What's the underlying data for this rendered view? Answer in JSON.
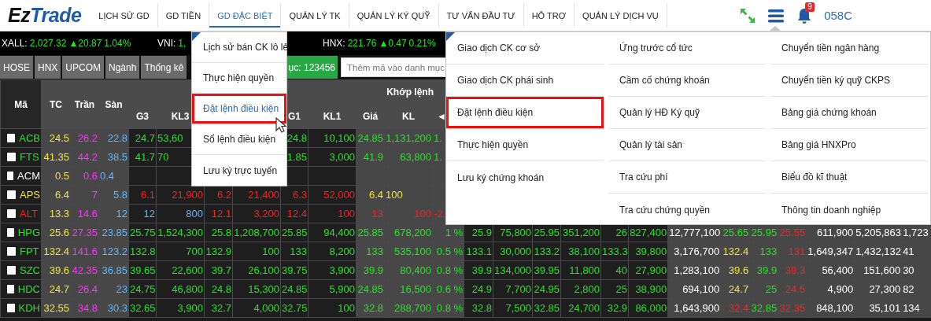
{
  "nav": {
    "logo": {
      "first": "Ez",
      "second": "Trade"
    },
    "items": [
      {
        "label": "LỊCH SỬ GD",
        "selected": false
      },
      {
        "label": "GD TIỀN",
        "selected": false
      },
      {
        "label": "GD ĐẶC BIỆT",
        "selected": true
      },
      {
        "label": "QUẢN LÝ TK",
        "selected": false
      },
      {
        "label": "QUẢN LÝ KÝ QUỸ",
        "selected": false
      },
      {
        "label": "TƯ VẤN ĐẦU TƯ",
        "selected": false
      },
      {
        "label": "HỖ TRỢ",
        "selected": false
      },
      {
        "label": "QUẢN LÝ DỊCH VỤ",
        "selected": false
      }
    ],
    "notifications": "9",
    "account": "058C"
  },
  "ticker": [
    {
      "label": "XALL:",
      "value": "2,027.32",
      "change": "▲20.87",
      "percent": "1.04%"
    },
    {
      "label": "VNI:",
      "value": "1,"
    },
    {
      "label": "HNX:",
      "value": "221.76",
      "change": "▲0.47",
      "percent": "0.21%"
    }
  ],
  "market_tabs": [
    "HOSE",
    "HNX",
    "UPCOM",
    "Ngành",
    "Thống kê"
  ],
  "watchlist_button": "ục: 123456",
  "add_symbol": {
    "placeholder": "Thêm mã vào danh mục"
  },
  "table": {
    "headers": [
      "Mã",
      "TC",
      "Trần",
      "Sàn"
    ],
    "group_header": "Khớp lệnh",
    "sub_headers": [
      "G3",
      "KL3",
      "G1",
      "KL1",
      "Giá",
      "KL",
      "◄"
    ],
    "rows": [
      {
        "symbol": "ACB",
        "color": "#22e622",
        "checked": false,
        "cells": [
          {
            "text": "24.5",
            "color": "#f0e43c"
          },
          {
            "text": "26.2",
            "color": "#ff33ff"
          },
          {
            "text": "22.8",
            "color": "#5cb8ff"
          },
          {
            "text": "24.7",
            "color": "#22e622"
          },
          {
            "text": "53,60",
            "color": "#22e622"
          },
          null,
          null,
          {
            "text": "24.8",
            "color": "#22e622"
          },
          {
            "text": "10,100",
            "color": "#22e622"
          },
          {
            "text": "24.85",
            "color": "#22e622"
          },
          {
            "text": "1,131,200",
            "color": "#22e622"
          },
          {
            "text": "1.",
            "color": "#22e622"
          },
          null,
          null,
          null,
          null,
          null,
          null,
          null,
          null,
          null,
          null,
          null,
          null,
          null
        ]
      },
      {
        "symbol": "FTS",
        "color": "#22e622",
        "checked": false,
        "cells": [
          {
            "text": "41.35",
            "color": "#f0e43c"
          },
          {
            "text": "44.2",
            "color": "#ff33ff"
          },
          {
            "text": "38.5",
            "color": "#5cb8ff"
          },
          {
            "text": "41.7",
            "color": "#22e622"
          },
          {
            "text": "70",
            "color": "#22e622"
          },
          null,
          null,
          {
            "text": "1.85",
            "color": "#22e622"
          },
          {
            "text": "3,000",
            "color": "#22e622"
          },
          {
            "text": "41.9",
            "color": "#22e622"
          },
          {
            "text": "63,800",
            "color": "#22e622"
          },
          {
            "text": "1.",
            "color": "#22e622"
          },
          null,
          null,
          null,
          null,
          null,
          null,
          null,
          null,
          null,
          null,
          null,
          null,
          null
        ]
      },
      {
        "symbol": "ACM",
        "color": "#ffffff",
        "checked": false,
        "cells": [
          {
            "text": "0.5",
            "color": "#f0e43c"
          },
          {
            "text": "0.6",
            "color": "#ff33ff"
          },
          {
            "text": "0.4",
            "color": "#5cb8ff"
          },
          null,
          null,
          null,
          null,
          null,
          null,
          null,
          null,
          null,
          null,
          null,
          null,
          null,
          null,
          null,
          null,
          null,
          null,
          null,
          null,
          null,
          null
        ]
      },
      {
        "symbol": "APS",
        "color": "#f0e43c",
        "checked": false,
        "cells": [
          {
            "text": "6.4",
            "color": "#f0e43c"
          },
          {
            "text": "7",
            "color": "#ff33ff"
          },
          {
            "text": "5.8",
            "color": "#5cb8ff"
          },
          {
            "text": "6.1",
            "color": "#ff2020"
          },
          {
            "text": "21,900",
            "color": "#ff2020"
          },
          {
            "text": "6.2",
            "color": "#ff2020"
          },
          {
            "text": "21,400",
            "color": "#ff2020"
          },
          {
            "text": "6.3",
            "color": "#ff2020"
          },
          {
            "text": "52,000",
            "color": "#ff2020"
          },
          {
            "text": "6.4",
            "color": "#f0e43c"
          },
          {
            "text": "100",
            "color": "#f0e43c"
          },
          null,
          null,
          null,
          null,
          null,
          null,
          null,
          null,
          null,
          null,
          null,
          null,
          null,
          null
        ]
      },
      {
        "symbol": "ALT",
        "color": "#ff2020",
        "checked": false,
        "cells": [
          {
            "text": "13.3",
            "color": "#f0e43c"
          },
          {
            "text": "14.6",
            "color": "#ff33ff"
          },
          {
            "text": "12",
            "color": "#5cb8ff"
          },
          {
            "text": "12",
            "color": "#5cb8ff"
          },
          {
            "text": "800",
            "color": "#5cb8ff"
          },
          {
            "text": "12.1",
            "color": "#ff2020"
          },
          {
            "text": "3,200",
            "color": "#ff2020"
          },
          {
            "text": "12.4",
            "color": "#ff2020"
          },
          {
            "text": "100",
            "color": "#ff2020"
          },
          {
            "text": "13",
            "color": "#ff2020"
          },
          {
            "text": "100",
            "color": "#ff2020"
          },
          {
            "text": "-2.",
            "color": "#ff2020"
          },
          null,
          null,
          null,
          null,
          null,
          null,
          null,
          null,
          null,
          null,
          null,
          null,
          null
        ]
      },
      {
        "symbol": "HPG",
        "color": "#22e622",
        "checked": false,
        "cells": [
          {
            "text": "25.6",
            "color": "#f0e43c"
          },
          {
            "text": "27.35",
            "color": "#ff33ff"
          },
          {
            "text": "23.85",
            "color": "#5cb8ff"
          },
          {
            "text": "25.75",
            "color": "#22e622"
          },
          {
            "text": "1,524,300",
            "color": "#22e622"
          },
          {
            "text": "25.8",
            "color": "#22e622"
          },
          {
            "text": "1,208,700",
            "color": "#22e622"
          },
          {
            "text": "25.85",
            "color": "#22e622"
          },
          {
            "text": "94,400",
            "color": "#22e622"
          },
          {
            "text": "25.85",
            "color": "#22e622"
          },
          {
            "text": "678,200",
            "color": "#22e622"
          },
          {
            "text": "1 %",
            "color": "#22e622"
          },
          {
            "text": "25.9",
            "color": "#22e622"
          },
          {
            "text": "75,800",
            "color": "#22e622"
          },
          {
            "text": "25.95",
            "color": "#22e622"
          },
          {
            "text": "351,200",
            "color": "#22e622"
          },
          {
            "text": "26",
            "color": "#22e622"
          },
          {
            "text": "827,400",
            "color": "#22e622"
          },
          {
            "text": "12,777,100",
            "color": "#ffffff"
          },
          {
            "text": "25.65",
            "color": "#22e622"
          },
          {
            "text": "25.95",
            "color": "#22e622"
          },
          {
            "text": "25.55",
            "color": "#ff2020"
          },
          {
            "text": "611,900",
            "color": "#ffffff"
          },
          {
            "text": "5,205,863",
            "color": "#ffffff"
          },
          {
            "text": "1,723",
            "color": "#ffffff"
          }
        ]
      },
      {
        "symbol": "FPT",
        "color": "#22e622",
        "checked": false,
        "cells": [
          {
            "text": "132.4",
            "color": "#f0e43c"
          },
          {
            "text": "141.6",
            "color": "#ff33ff"
          },
          {
            "text": "123.2",
            "color": "#5cb8ff"
          },
          {
            "text": "132.8",
            "color": "#22e622"
          },
          {
            "text": "700",
            "color": "#22e622"
          },
          {
            "text": "132.9",
            "color": "#22e622"
          },
          {
            "text": "100",
            "color": "#22e622"
          },
          {
            "text": "133",
            "color": "#22e622"
          },
          {
            "text": "8,200",
            "color": "#22e622"
          },
          {
            "text": "133",
            "color": "#22e622"
          },
          {
            "text": "535,100",
            "color": "#22e622"
          },
          {
            "text": "0.5 %",
            "color": "#22e622"
          },
          {
            "text": "133.1",
            "color": "#22e622"
          },
          {
            "text": "30,000",
            "color": "#22e622"
          },
          {
            "text": "133.2",
            "color": "#22e622"
          },
          {
            "text": "38,100",
            "color": "#22e622"
          },
          {
            "text": "133.3",
            "color": "#22e622"
          },
          {
            "text": "39,800",
            "color": "#22e622"
          },
          {
            "text": "3,176,700",
            "color": "#ffffff"
          },
          {
            "text": "132.4",
            "color": "#f0e43c"
          },
          {
            "text": "133",
            "color": "#22e622"
          },
          {
            "text": "131",
            "color": "#ff2020"
          },
          {
            "text": "1,649,347",
            "color": "#ffffff"
          },
          {
            "text": "1,432,132",
            "color": "#ffffff"
          },
          {
            "text": "41",
            "color": "#ffffff"
          }
        ]
      },
      {
        "symbol": "SZC",
        "color": "#22e622",
        "checked": false,
        "cells": [
          {
            "text": "39.6",
            "color": "#f0e43c"
          },
          {
            "text": "42.35",
            "color": "#ff33ff"
          },
          {
            "text": "36.85",
            "color": "#5cb8ff"
          },
          {
            "text": "39.65",
            "color": "#22e622"
          },
          {
            "text": "22,600",
            "color": "#22e622"
          },
          {
            "text": "39.7",
            "color": "#22e622"
          },
          {
            "text": "26,100",
            "color": "#22e622"
          },
          {
            "text": "39.75",
            "color": "#22e622"
          },
          {
            "text": "3,900",
            "color": "#22e622"
          },
          {
            "text": "39.9",
            "color": "#22e622"
          },
          {
            "text": "80,400",
            "color": "#22e622"
          },
          {
            "text": "0.8 %",
            "color": "#22e622"
          },
          {
            "text": "39.9",
            "color": "#22e622"
          },
          {
            "text": "134,000",
            "color": "#22e622"
          },
          {
            "text": "39.95",
            "color": "#22e622"
          },
          {
            "text": "11,800",
            "color": "#22e622"
          },
          {
            "text": "40",
            "color": "#22e622"
          },
          {
            "text": "27,900",
            "color": "#22e622"
          },
          {
            "text": "1,283,100",
            "color": "#ffffff"
          },
          {
            "text": "39.6",
            "color": "#f0e43c"
          },
          {
            "text": "39.9",
            "color": "#22e622"
          },
          {
            "text": "39.3",
            "color": "#ff2020"
          },
          {
            "text": "56,400",
            "color": "#ffffff"
          },
          {
            "text": "151,600",
            "color": "#ffffff"
          },
          {
            "text": "30",
            "color": "#ffffff"
          }
        ]
      },
      {
        "symbol": "HDC",
        "color": "#22e622",
        "checked": false,
        "cells": [
          {
            "text": "24.7",
            "color": "#f0e43c"
          },
          {
            "text": "26.4",
            "color": "#ff33ff"
          },
          {
            "text": "23",
            "color": "#5cb8ff"
          },
          {
            "text": "24.75",
            "color": "#22e622"
          },
          {
            "text": "46,800",
            "color": "#22e622"
          },
          {
            "text": "24.8",
            "color": "#22e622"
          },
          {
            "text": "15,300",
            "color": "#22e622"
          },
          {
            "text": "24.85",
            "color": "#22e622"
          },
          {
            "text": "5,900",
            "color": "#22e622"
          },
          {
            "text": "24.85",
            "color": "#22e622"
          },
          {
            "text": "16,500",
            "color": "#22e622"
          },
          {
            "text": "0.6 %",
            "color": "#22e622"
          },
          {
            "text": "24.9",
            "color": "#22e622"
          },
          {
            "text": "7,700",
            "color": "#22e622"
          },
          {
            "text": "24.95",
            "color": "#22e622"
          },
          {
            "text": "2,800",
            "color": "#22e622"
          },
          {
            "text": "25",
            "color": "#22e622"
          },
          {
            "text": "38,900",
            "color": "#22e622"
          },
          {
            "text": "694,100",
            "color": "#ffffff"
          },
          {
            "text": "24.7",
            "color": "#f0e43c"
          },
          {
            "text": "25",
            "color": "#22e622"
          },
          {
            "text": "24.5",
            "color": "#ff2020"
          },
          {
            "text": "4,900",
            "color": "#ffffff"
          },
          {
            "text": "27,300",
            "color": "#ffffff"
          },
          {
            "text": "82",
            "color": "#ffffff"
          }
        ]
      },
      {
        "symbol": "KDH",
        "color": "#22e622",
        "checked": false,
        "cells": [
          {
            "text": "32.55",
            "color": "#f0e43c"
          },
          {
            "text": "34.8",
            "color": "#ff33ff"
          },
          {
            "text": "30.3",
            "color": "#5cb8ff"
          },
          {
            "text": "32.65",
            "color": "#22e622"
          },
          {
            "text": "3,900",
            "color": "#22e622"
          },
          {
            "text": "32.7",
            "color": "#22e622"
          },
          {
            "text": "4,000",
            "color": "#22e622"
          },
          {
            "text": "32.75",
            "color": "#22e622"
          },
          {
            "text": "100",
            "color": "#22e622"
          },
          {
            "text": "32.8",
            "color": "#22e622"
          },
          {
            "text": "288,700",
            "color": "#22e622"
          },
          {
            "text": "0.8 %",
            "color": "#22e622"
          },
          {
            "text": "32.8",
            "color": "#22e622"
          },
          {
            "text": "7,500",
            "color": "#22e622"
          },
          {
            "text": "32.85",
            "color": "#22e622"
          },
          {
            "text": "24,700",
            "color": "#22e622"
          },
          {
            "text": "32.9",
            "color": "#22e622"
          },
          {
            "text": "86,000",
            "color": "#22e622"
          },
          {
            "text": "1,643,900",
            "color": "#ffffff"
          },
          {
            "text": "32.4",
            "color": "#ff2020"
          },
          {
            "text": "32.85",
            "color": "#22e622"
          },
          {
            "text": "32.35",
            "color": "#ff2020"
          },
          {
            "text": "848,100",
            "color": "#ffffff"
          },
          {
            "text": "35,101",
            "color": "#ffffff"
          },
          {
            "text": "134",
            "color": "#ffffff"
          }
        ]
      }
    ]
  },
  "special_menu": {
    "items": [
      {
        "label": "Lịch sử bán CK lô lẻ",
        "selected": false,
        "highlighted": false
      },
      {
        "label": "Thực hiện quyền",
        "selected": false,
        "highlighted": false
      },
      {
        "label": "Đặt lệnh điều kiện",
        "selected": true,
        "highlighted": true
      },
      {
        "label": "Sổ lệnh điều kiện",
        "selected": false,
        "highlighted": false
      },
      {
        "label": "Lưu ký trực tuyến",
        "selected": false,
        "highlighted": false
      }
    ]
  },
  "main_menu": {
    "columns": [
      [
        {
          "label": "Giao dịch CK cơ sở",
          "highlighted": false
        },
        {
          "label": "Giao dịch CK phái sinh",
          "highlighted": false
        },
        {
          "label": "Đặt lệnh điều kiện",
          "highlighted": true
        },
        {
          "label": "Thực hiện quyền",
          "highlighted": false
        },
        {
          "label": "Lưu ký chứng khoán",
          "highlighted": false
        }
      ],
      [
        {
          "label": "Ứng trước cổ tức",
          "highlighted": false
        },
        {
          "label": "Cầm cố chứng khoán",
          "highlighted": false
        },
        {
          "label": "Quản lý HĐ Ký quỹ",
          "highlighted": false
        },
        {
          "label": "Quản lý tài sản",
          "highlighted": false
        },
        {
          "label": "Tra cứu phí",
          "highlighted": false
        },
        {
          "label": "Tra cứu chứng quyền",
          "highlighted": false
        }
      ],
      [
        {
          "label": "Chuyển tiền ngân hàng",
          "highlighted": false
        },
        {
          "label": "Chuyển tiền ký quỹ CKPS",
          "highlighted": false
        },
        {
          "label": "Bảng giá chứng khoán",
          "highlighted": false
        },
        {
          "label": "Bảng giá HNXPro",
          "highlighted": false
        },
        {
          "label": "Biểu đồ kĩ thuật",
          "highlighted": false
        },
        {
          "label": "Thông tin doanh nghiệp",
          "highlighted": false
        }
      ]
    ]
  }
}
